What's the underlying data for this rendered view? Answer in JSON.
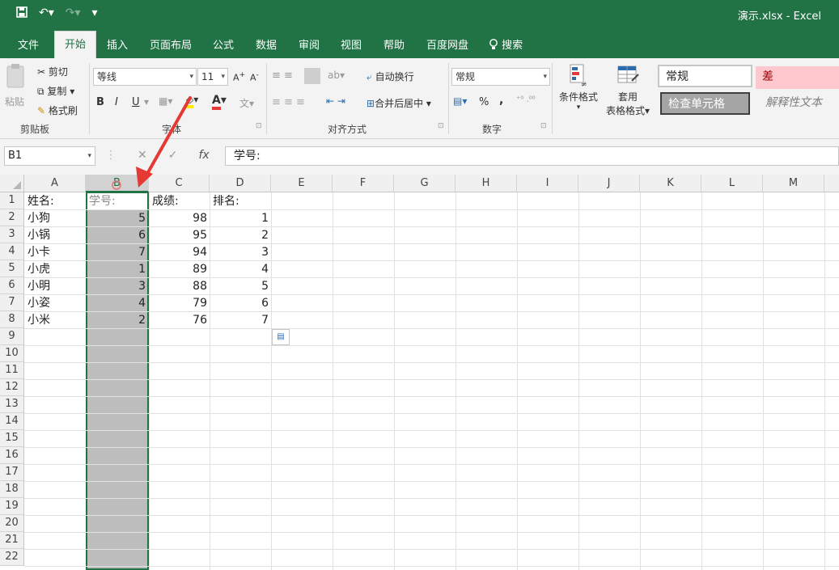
{
  "titlebar": {
    "save_icon": "save-icon",
    "undo_icon": "undo-icon",
    "redo_icon": "redo-icon",
    "customize_icon": "customize-qat-icon",
    "doc_title": "演示.xlsx  -  Excel"
  },
  "tabs": [
    {
      "label": "文件",
      "active": false
    },
    {
      "label": "开始",
      "active": true
    },
    {
      "label": "插入",
      "active": false
    },
    {
      "label": "页面布局",
      "active": false
    },
    {
      "label": "公式",
      "active": false
    },
    {
      "label": "数据",
      "active": false
    },
    {
      "label": "审阅",
      "active": false
    },
    {
      "label": "视图",
      "active": false
    },
    {
      "label": "帮助",
      "active": false
    },
    {
      "label": "百度网盘",
      "active": false
    },
    {
      "label": "搜索",
      "active": false
    }
  ],
  "ribbon": {
    "clipboard": {
      "paste": "粘贴",
      "cut": "剪切",
      "copy": "复制",
      "format_painter": "格式刷",
      "label": "剪贴板"
    },
    "font": {
      "name": "等线",
      "size": "11",
      "bold": "B",
      "italic": "I",
      "underline": "U",
      "label": "字体"
    },
    "alignment": {
      "wrap": "自动换行",
      "merge": "合并后居中",
      "label": "对齐方式"
    },
    "number": {
      "format": "常规",
      "percent": "%",
      "comma": ",",
      "label": "数字"
    },
    "styles": {
      "conditional": "条件格式",
      "table_line1": "套用",
      "table_line2": "表格格式",
      "normal": "常规",
      "bad": "差",
      "check": "检查单元格",
      "explanatory": "解释性文本"
    }
  },
  "formula_bar": {
    "name_box": "B1",
    "cancel": "✕",
    "enter": "✓",
    "fx": "fx",
    "content": "学号:"
  },
  "sheet": {
    "columns": [
      "A",
      "B",
      "C",
      "D",
      "E",
      "F",
      "G",
      "H",
      "I",
      "J",
      "K",
      "L",
      "M"
    ],
    "rows": [
      "1",
      "2",
      "3",
      "4",
      "5",
      "6",
      "7",
      "8",
      "9",
      "10",
      "11",
      "12",
      "13",
      "14",
      "15",
      "16",
      "17",
      "18",
      "19",
      "20",
      "21",
      "22"
    ],
    "selected_column": "B",
    "header": [
      "姓名:",
      "学号:",
      "成绩:",
      "排名:"
    ],
    "data": [
      [
        "小狗",
        "5",
        "98",
        "1"
      ],
      [
        "小锅",
        "6",
        "95",
        "2"
      ],
      [
        "小卡",
        "7",
        "94",
        "3"
      ],
      [
        "小虎",
        "1",
        "89",
        "4"
      ],
      [
        "小明",
        "3",
        "88",
        "5"
      ],
      [
        "小姿",
        "4",
        "79",
        "6"
      ],
      [
        "小米",
        "2",
        "76",
        "7"
      ]
    ]
  },
  "colors": {
    "accent": "#217346",
    "selection": "#bdbdbd",
    "arrow": "#e53935",
    "bad_fill": "#ffc7ce",
    "bad_text": "#9c0006"
  }
}
